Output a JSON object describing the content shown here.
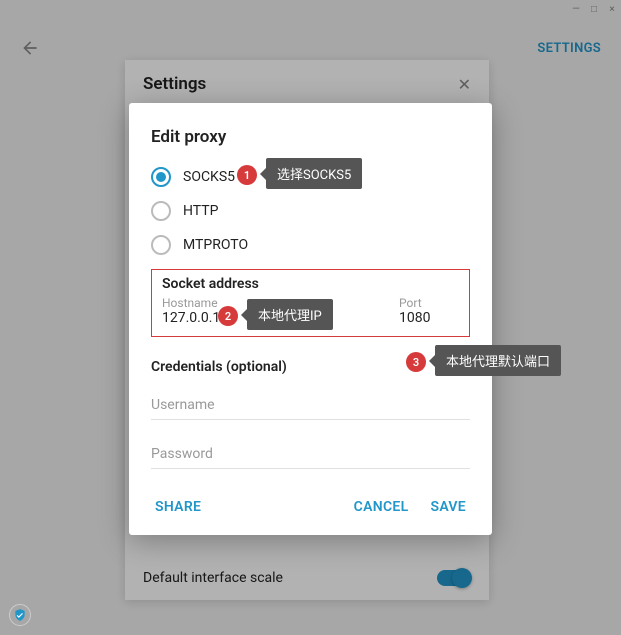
{
  "window": {
    "min": "—",
    "max": "□",
    "close": "×"
  },
  "topbar": {
    "settings": "SETTINGS"
  },
  "settings_panel": {
    "title": "Settings",
    "interface_scale": "Default interface scale"
  },
  "modal": {
    "title": "Edit proxy",
    "radios": {
      "socks5": "SOCKS5",
      "http": "HTTP",
      "mtproto": "MTPROTO"
    },
    "socket_title": "Socket address",
    "hostname_label": "Hostname",
    "hostname_value": "127.0.0.1",
    "port_label": "Port",
    "port_value": "1080",
    "cred_title": "Credentials (optional)",
    "username_ph": "Username",
    "password_ph": "Password",
    "share": "SHARE",
    "cancel": "CANCEL",
    "save": "SAVE"
  },
  "callouts": {
    "b1": "1",
    "t1": "选择SOCKS5",
    "b2": "2",
    "t2": "本地代理IP",
    "b3": "3",
    "t3": "本地代理默认端口"
  }
}
